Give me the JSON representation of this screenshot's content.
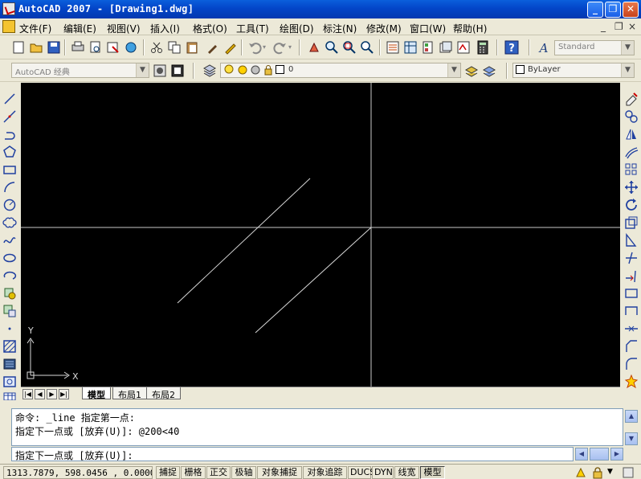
{
  "window": {
    "title": "AutoCAD 2007 - [Drawing1.dwg]",
    "minimize": "_",
    "restore": "❐",
    "close": "✕"
  },
  "menu": {
    "items": [
      "文件(F)",
      "编辑(E)",
      "视图(V)",
      "插入(I)",
      "格式(O)",
      "工具(T)",
      "绘图(D)",
      "标注(N)",
      "修改(M)",
      "窗口(W)",
      "帮助(H)"
    ],
    "doc_min": "_",
    "doc_restore": "❐",
    "doc_close": "×"
  },
  "toolbar": {
    "text_style": "Standard",
    "workspace": "AutoCAD 经典",
    "layer_value": "0",
    "linetype": "ByLayer"
  },
  "canvas": {
    "axis_x_label": "X",
    "axis_y_label": "Y"
  },
  "tabs": {
    "model": "模型",
    "layout1": "布局1",
    "layout2": "布局2"
  },
  "command": {
    "history_line1": "命令: _line 指定第一点:",
    "history_line2": "指定下一点或 [放弃(U)]: @200<40",
    "prompt": "指定下一点或 [放弃(U)]:"
  },
  "status": {
    "coordinates": "1313.7879, 598.0456 , 0.0000",
    "buttons": [
      "捕捉",
      "栅格",
      "正交",
      "极轴",
      "对象捕捉",
      "对象追踪",
      "DUCS",
      "DYN",
      "线宽",
      "模型"
    ]
  },
  "colors": {
    "canvas_bg": "#000000",
    "crosshair": "#c8c8c8",
    "line": "#d8d8d8",
    "titlebar": "#0a5fdc"
  }
}
